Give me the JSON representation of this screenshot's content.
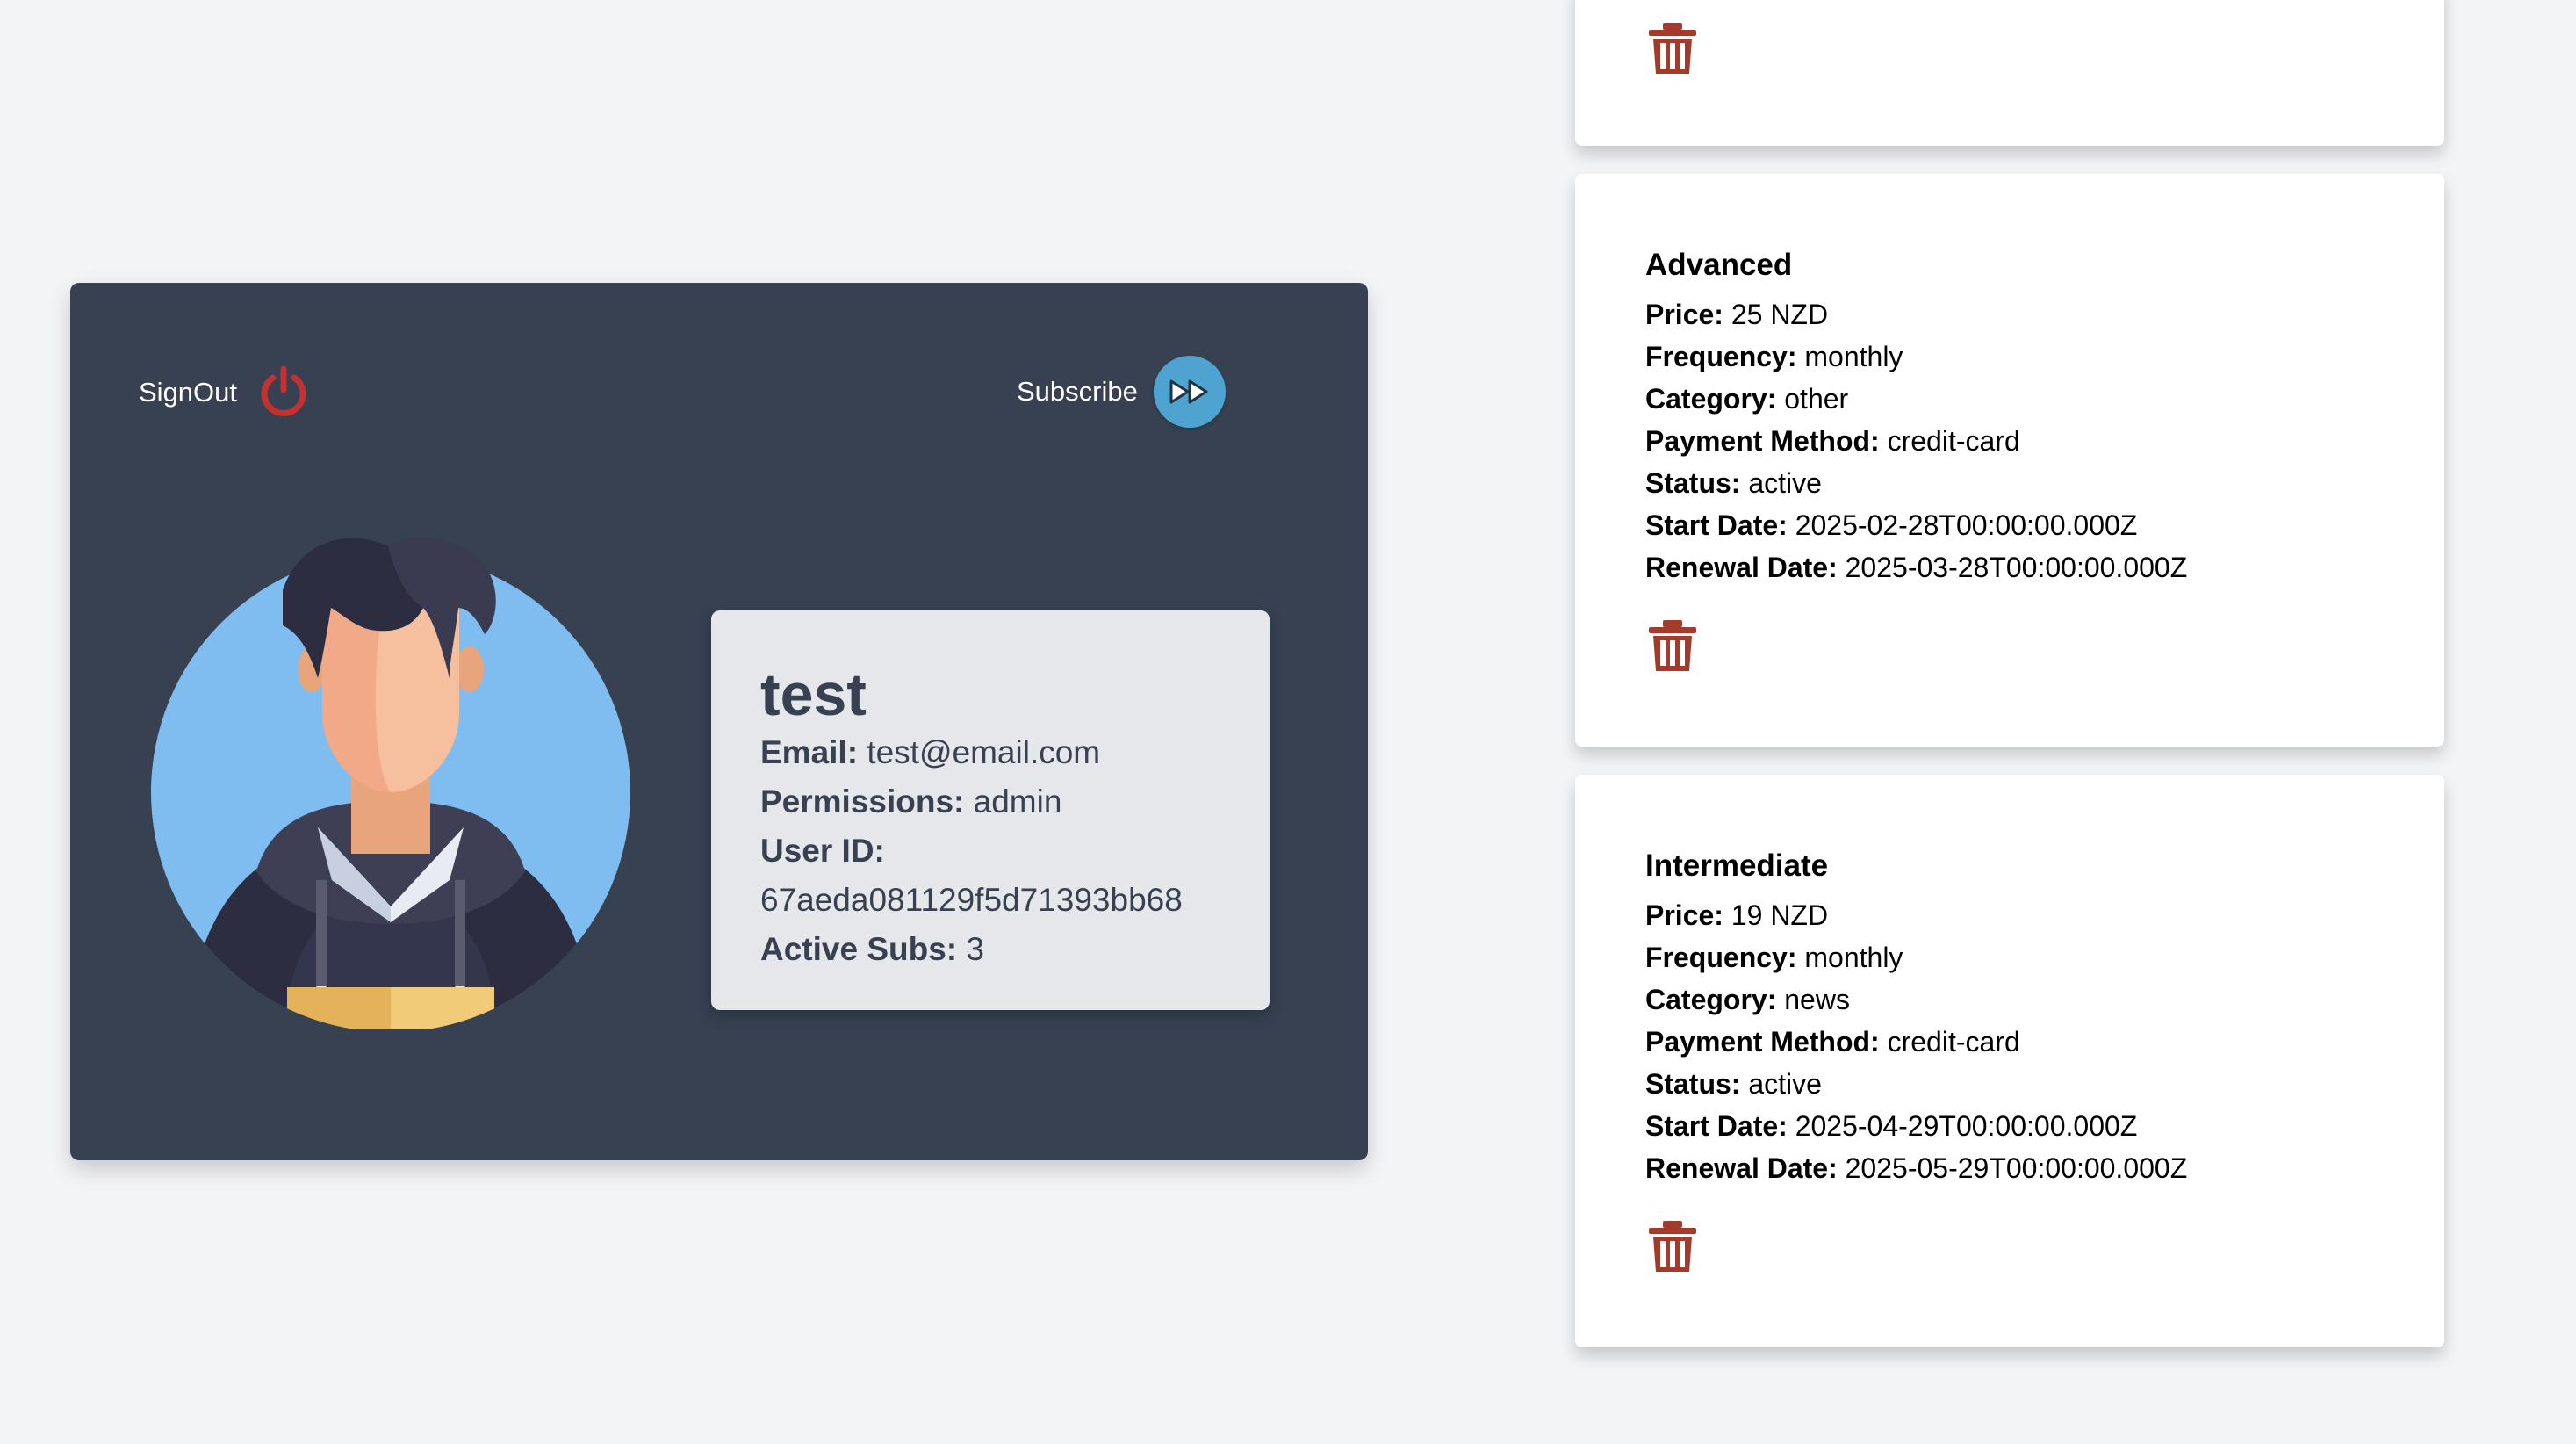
{
  "profile": {
    "signout_label": "SignOut",
    "subscribe_label": "Subscribe",
    "name": "test",
    "email_label": "Email:",
    "email": "test@email.com",
    "permissions_label": "Permissions:",
    "permissions": "admin",
    "userid_label": "User ID:",
    "userid": "67aeda081129f5d71393bb68",
    "activesubs_label": "Active Subs:",
    "activesubs": "3"
  },
  "labels": {
    "price": "Price:",
    "frequency": "Frequency:",
    "category": "Category:",
    "payment": "Payment Method:",
    "status": "Status:",
    "start": "Start Date:",
    "renewal": "Renewal Date:"
  },
  "subscriptions": [
    {
      "name": "Advanced",
      "price": "25 NZD",
      "frequency": "monthly",
      "category": "other",
      "payment": "credit-card",
      "status": "active",
      "start": "2025-02-28T00:00:00.000Z",
      "renewal": "2025-03-28T00:00:00.000Z"
    },
    {
      "name": "Intermediate",
      "price": "19 NZD",
      "frequency": "monthly",
      "category": "news",
      "payment": "credit-card",
      "status": "active",
      "start": "2025-04-29T00:00:00.000Z",
      "renewal": "2025-05-29T00:00:00.000Z"
    }
  ],
  "colors": {
    "page_bg": "#f3f4f6",
    "card_dark": "#374151",
    "info_box": "#e5e7eb",
    "power_red": "#c53030",
    "subscribe_blue": "#4ea3d1",
    "trash_red": "#a33a2c"
  },
  "icons": {
    "signout": "power-icon",
    "subscribe": "fast-forward-icon",
    "delete": "trash-icon",
    "avatar": "user-avatar-illustration"
  }
}
